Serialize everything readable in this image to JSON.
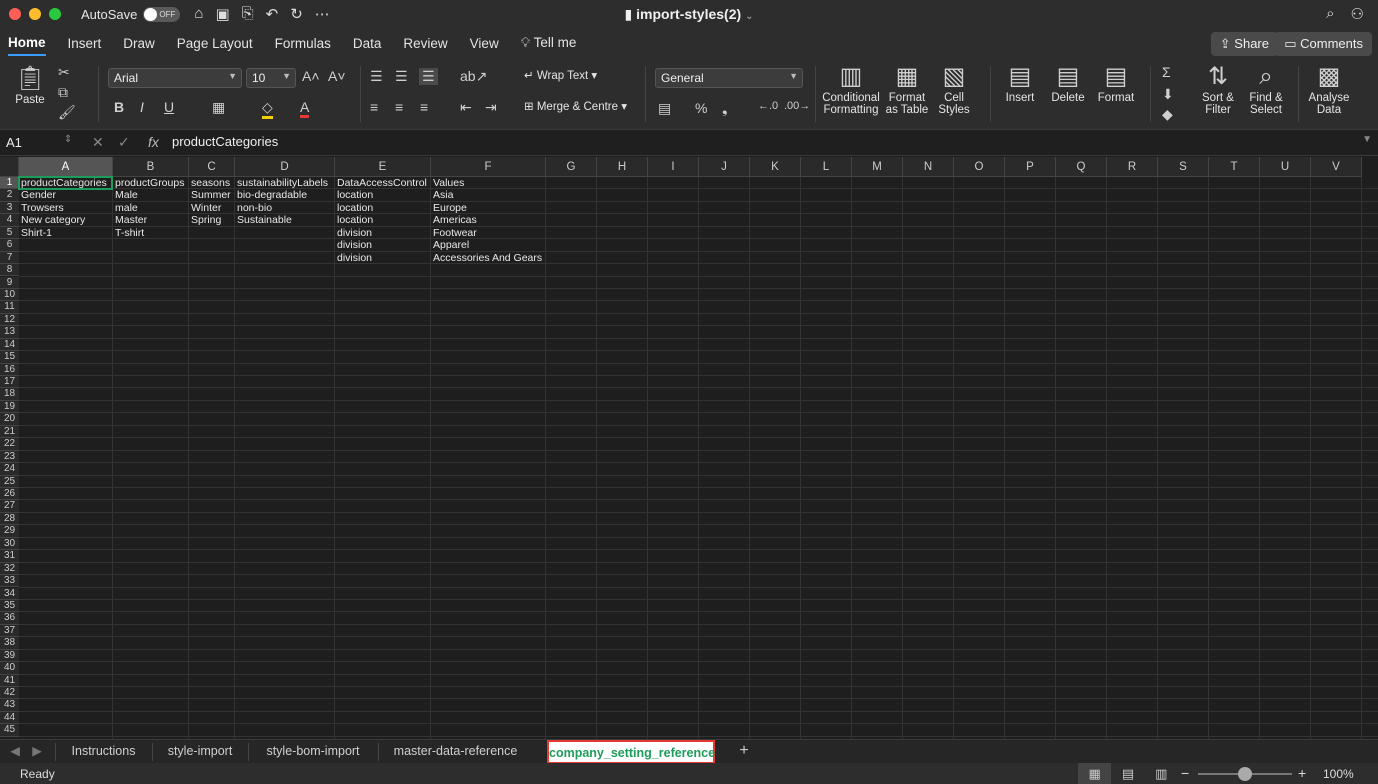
{
  "window": {
    "title": "import-styles(2)",
    "autosave_label": "AutoSave",
    "autosave_state": "OFF"
  },
  "ribbon_tabs": [
    "Home",
    "Insert",
    "Draw",
    "Page Layout",
    "Formulas",
    "Data",
    "Review",
    "View",
    "Tell me"
  ],
  "ribbon_active_tab": "Home",
  "header_buttons": {
    "share": "Share",
    "comments": "Comments"
  },
  "ribbon": {
    "paste": "Paste",
    "font_name": "Arial",
    "font_size": "10",
    "wrap_text": "Wrap Text",
    "merge_centre": "Merge & Centre",
    "number_format": "General",
    "conditional_formatting": "Conditional Formatting",
    "format_as_table": "Format as Table",
    "cell_styles": "Cell Styles",
    "insert": "Insert",
    "delete": "Delete",
    "format": "Format",
    "sort_filter": "Sort & Filter",
    "find_select": "Find & Select",
    "analyse_data": "Analyse Data"
  },
  "formula_bar": {
    "name_box": "A1",
    "fx": "fx",
    "content": "productCategories"
  },
  "columns": [
    "A",
    "B",
    "C",
    "D",
    "E",
    "F",
    "G",
    "H",
    "I",
    "J",
    "K",
    "L",
    "M",
    "N",
    "O",
    "P",
    "Q",
    "R",
    "S",
    "T",
    "U",
    "V"
  ],
  "row_count": 45,
  "cells": [
    [
      "productCategories",
      "productGroups",
      "seasons",
      "sustainabilityLabels",
      "DataAccessControl",
      "Values"
    ],
    [
      "Gender",
      "Male",
      "Summer",
      "bio-degradable",
      "location",
      "Asia"
    ],
    [
      "Trowsers",
      "male",
      "Winter",
      "non-bio",
      "location",
      "Europe"
    ],
    [
      "New category",
      "Master",
      "Spring",
      "Sustainable",
      "location",
      "Americas"
    ],
    [
      "Shirt-1",
      "T-shirt",
      "",
      "",
      "division",
      "Footwear"
    ],
    [
      "",
      "",
      "",
      "",
      "division",
      "Apparel"
    ],
    [
      "",
      "",
      "",
      "",
      "division",
      "Accessories And Gears"
    ]
  ],
  "sheets": [
    "Instructions",
    "style-import",
    "style-bom-import",
    "master-data-reference",
    "company_setting_reference"
  ],
  "active_sheet": "company_setting_reference",
  "status": {
    "ready": "Ready",
    "zoom": "100%"
  }
}
